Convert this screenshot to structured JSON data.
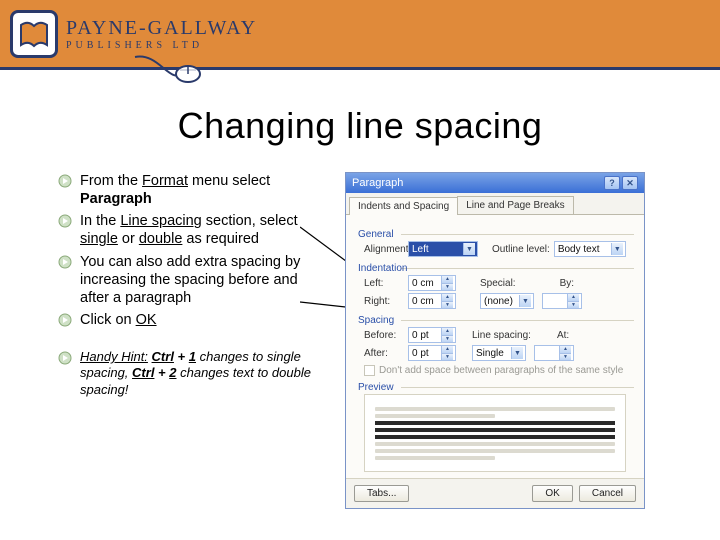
{
  "brand": {
    "name": "PAYNE-GALLWAY",
    "subtitle": "PUBLISHERS LTD"
  },
  "title": "Changing line spacing",
  "bullets": {
    "b1_p1": "From the ",
    "b1_format": "Format",
    "b1_p2": " menu select ",
    "b1_para": "Paragraph",
    "b2_p1": "In the ",
    "b2_ls": "Line spacing",
    "b2_p2": " section, select ",
    "b2_single": "single",
    "b2_p3": " or ",
    "b2_double": "double",
    "b2_p4": " as required",
    "b3": "You can also add extra spacing by increasing the spacing before and after a paragraph",
    "b4_p1": "Click on ",
    "b4_ok": "OK"
  },
  "hint": {
    "label": "Handy Hint:",
    "p1": "  ",
    "ctrl1": "Ctrl",
    "plus": " + ",
    "one": "1",
    "p2": " changes to single spacing, ",
    "ctrl2": "Ctrl",
    "two": "2",
    "p3": " changes text to double spacing!"
  },
  "dialog": {
    "title": "Paragraph",
    "help_glyph": "?",
    "close_glyph": "✕",
    "tabs": {
      "t1": "Indents and Spacing",
      "t2": "Line and Page Breaks"
    },
    "general": {
      "title": "General",
      "alignment_label": "Alignment:",
      "alignment_value": "Left",
      "outline_label": "Outline level:",
      "outline_value": "Body text"
    },
    "indentation": {
      "title": "Indentation",
      "left_label": "Left:",
      "left_value": "0 cm",
      "right_label": "Right:",
      "right_value": "0 cm",
      "special_label": "Special:",
      "special_value": "(none)",
      "by_label": "By:",
      "by_value": ""
    },
    "spacing": {
      "title": "Spacing",
      "before_label": "Before:",
      "before_value": "0 pt",
      "after_label": "After:",
      "after_value": "0 pt",
      "line_label": "Line spacing:",
      "line_value": "Single",
      "at_label": "At:",
      "at_value": ""
    },
    "checkbox_label": "Don't add space between paragraphs of the same style",
    "preview_title": "Preview",
    "buttons": {
      "tabs": "Tabs...",
      "ok": "OK",
      "cancel": "Cancel"
    }
  }
}
